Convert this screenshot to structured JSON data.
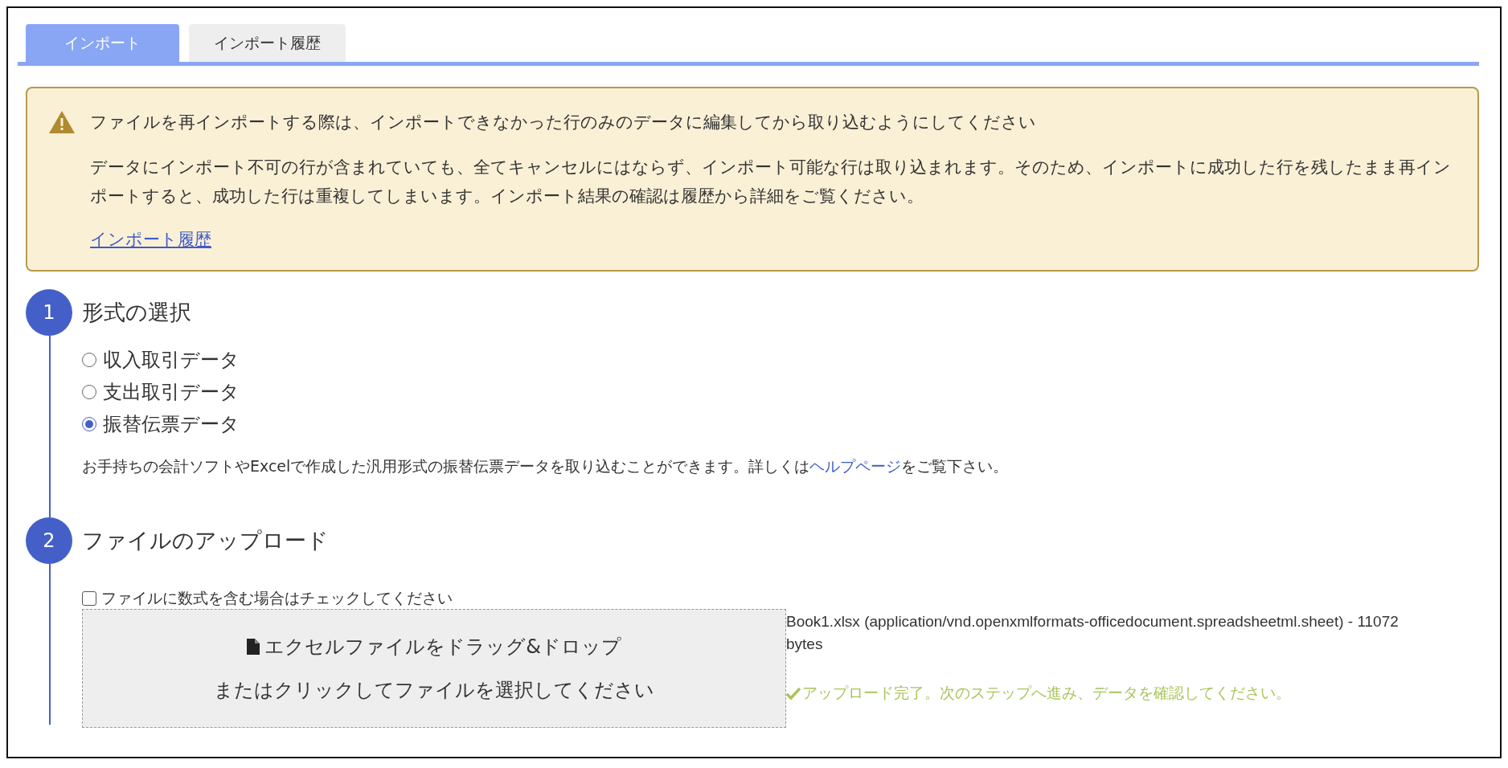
{
  "tabs": [
    {
      "label": "インポート",
      "selected": true
    },
    {
      "label": "インポート履歴",
      "selected": false
    }
  ],
  "notice": {
    "title": "ファイルを再インポートする際は、インポートできなかった行のみのデータに編集してから取り込むようにしてください",
    "body": "データにインポート不可の行が含まれていても、全てキャンセルにはならず、インポート可能な行は取り込まれます。そのため、インポートに成功した行を残したまま再インポートすると、成功した行は重複してしまいます。インポート結果の確認は履歴から詳細をご覧ください。",
    "link": "インポート履歴"
  },
  "format_step": {
    "number": "1",
    "title": "形式の選択",
    "options": [
      {
        "label": "収入取引データ",
        "selected": false
      },
      {
        "label": "支出取引データ",
        "selected": false
      },
      {
        "label": "振替伝票データ",
        "selected": true
      }
    ],
    "description": {
      "before": "お手持ちの会計ソフトやExcelで作成した汎用形式の振替伝票データを取り込むことができます。詳しくは",
      "link": "ヘルプページ",
      "after": "をご覧下さい。"
    }
  },
  "upload_step": {
    "number": "2",
    "title": "ファイルのアップロード",
    "formula_checkbox": {
      "label": "ファイルに数式を含む場合はチェックしてください",
      "checked": false
    },
    "dropzone": {
      "title": "エクセルファイルをドラッグ&ドロップ",
      "subtitle": "またはクリックしてファイルを選択してください"
    },
    "file_info": "Book1.xlsx (application/vnd.openxmlformats-officedocument.spreadsheetml.sheet) - 11072 bytes",
    "status": "アップロード完了。次のステップへ進み、データを確認してください。"
  }
}
